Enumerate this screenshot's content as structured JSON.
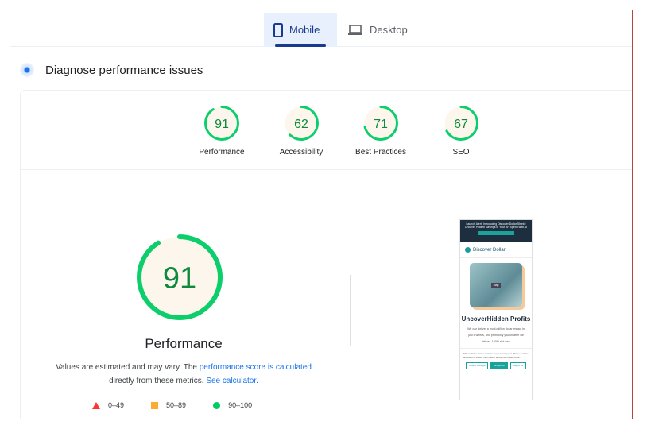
{
  "tabs": [
    {
      "label": "Mobile",
      "icon": "smartphone-icon",
      "selected": true
    },
    {
      "label": "Desktop",
      "icon": "laptop-icon",
      "selected": false
    }
  ],
  "section_title": "Diagnose performance issues",
  "colors": {
    "pass": "#0cce6b",
    "pass_text": "#0d8a3c",
    "gauge_fill": "#fdf6ec",
    "accent": "#1a73e8",
    "tab_selected": "#1a3a8f"
  },
  "scores": [
    {
      "label": "Performance",
      "value": "91",
      "fraction": 0.91
    },
    {
      "label": "Accessibility",
      "value": "62",
      "fraction": 0.62
    },
    {
      "label": "Best Practices",
      "value": "71",
      "fraction": 0.71
    },
    {
      "label": "SEO",
      "value": "67",
      "fraction": 0.67
    }
  ],
  "main": {
    "score": "91",
    "fraction": 0.91,
    "title": "Performance",
    "note_pre": "Values are estimated and may vary. The ",
    "note_link1": "performance score is calculated",
    "note_mid": " directly from these metrics. ",
    "note_link2": "See calculator."
  },
  "legend": [
    {
      "range": "0–49",
      "shape": "triangle"
    },
    {
      "range": "50–89",
      "shape": "square"
    },
    {
      "range": "90–100",
      "shape": "circle"
    }
  ],
  "screenshot": {
    "banner": "Launch Alert: Introducing Discover Dollar Shield! Uncover Hidden Savings in Your AP Spend with AI",
    "brand": "Discover Dollar",
    "image_label": "Map",
    "headline": "UncoverHidden Profits",
    "body": "We can deliver a multi-million dollar impact in just 6 weeks, and profit only you on after we deliver. 100% risk free",
    "cookie": "This website stores cookies on your computer. These cookies are used to collect information about how Read More...",
    "buttons": [
      "Cookie settings",
      "Accept All",
      "Reject All"
    ]
  }
}
